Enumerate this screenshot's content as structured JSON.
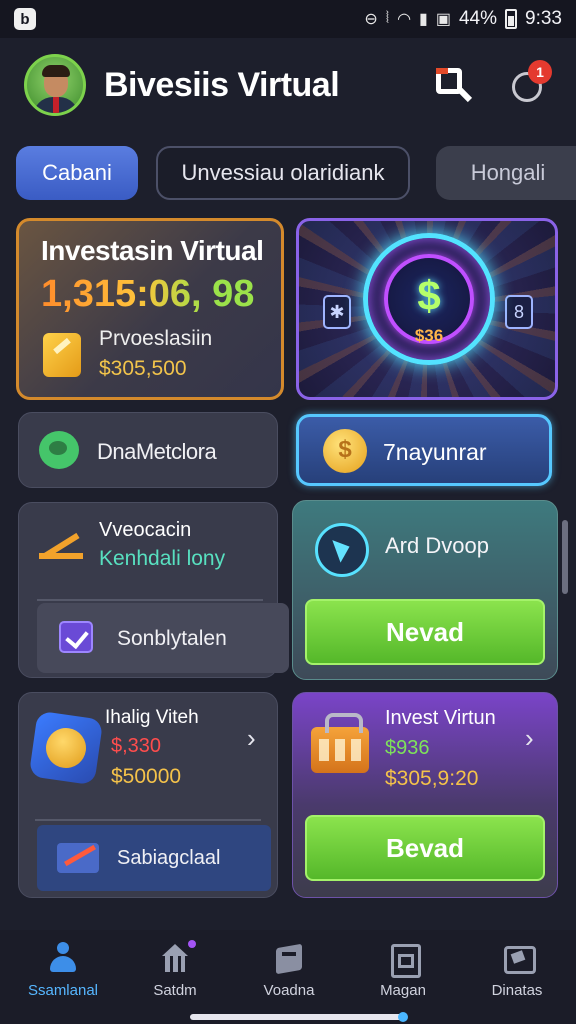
{
  "status_bar": {
    "app_glyph": "b",
    "battery": "44%",
    "time": "9:33",
    "icons": [
      "do-not-disturb-icon",
      "vibrate-icon",
      "wifi-icon",
      "signal-icon",
      "battery-icon"
    ]
  },
  "header": {
    "title": "Bivesiis Virtual",
    "notification_count": "1"
  },
  "tabs": [
    {
      "label": "Cabani",
      "active": true
    },
    {
      "label": "Unvessiau olaridiank",
      "active": false
    },
    {
      "label": "Hongali",
      "active": false
    }
  ],
  "investment_card": {
    "title": "Investasin Virtual",
    "amount": "1,315:06, 98",
    "sub_label": "Prvoeslasiin",
    "sub_value": "$305,500"
  },
  "coin_card": {
    "symbol": "$",
    "value": "$36",
    "left_chip": "✱",
    "right_chip": "8"
  },
  "quick_actions": {
    "left": {
      "label": "DnaMetclora"
    },
    "right": {
      "label": "7nayunrar"
    }
  },
  "list_card": {
    "title": "Vveocacin",
    "subtitle": "Kenhdali lony",
    "row_label": "Sonblytalen"
  },
  "drop_card": {
    "label": "Ard Dvoop",
    "button": "Nevad"
  },
  "wallet_card": {
    "title": "Ihalig Viteh",
    "value_red": "$,330",
    "value_gold": "$50000",
    "row_label": "Sabiagclaal"
  },
  "bag_card": {
    "title": "Invest Virtun",
    "value_green": "$936",
    "value_gold": "$305,9:20",
    "button": "Bevad"
  },
  "bottom_nav": [
    {
      "label": "Ssamlanal",
      "icon": "user-icon",
      "active": true
    },
    {
      "label": "Satdm",
      "icon": "house-icon",
      "active": false
    },
    {
      "label": "Voadna",
      "icon": "box-icon",
      "active": false
    },
    {
      "label": "Magan",
      "icon": "document-icon",
      "active": false
    },
    {
      "label": "Dinatas",
      "icon": "chat-icon",
      "active": false
    }
  ],
  "colors": {
    "background": "#1d1f2c",
    "accent_blue": "#5a7de0",
    "accent_green": "#6fd23a",
    "accent_orange": "#d48a2c",
    "accent_purple": "#8a63e8"
  }
}
